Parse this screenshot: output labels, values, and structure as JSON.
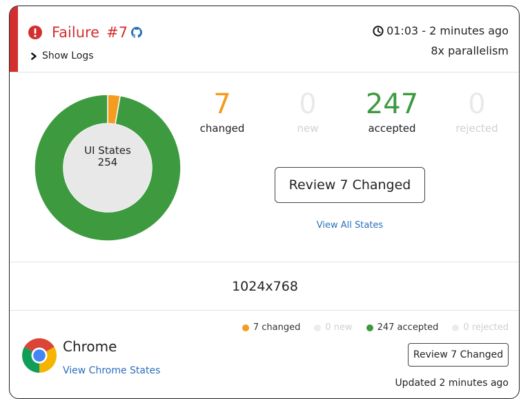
{
  "header": {
    "status": "Failure",
    "build_number": "#7",
    "show_logs_label": "Show Logs",
    "timing": "01:03 - 2 minutes ago",
    "parallelism": "8x parallelism"
  },
  "summary": {
    "donut": {
      "title": "UI States",
      "total": "254",
      "segments": [
        {
          "name": "changed",
          "value": 7,
          "color": "#f39c1f"
        },
        {
          "name": "new",
          "value": 0,
          "color": "#e9e9e9"
        },
        {
          "name": "accepted",
          "value": 247,
          "color": "#3d9a3f"
        },
        {
          "name": "rejected",
          "value": 0,
          "color": "#e9e9e9"
        }
      ]
    },
    "stats": [
      {
        "value": "7",
        "label": "changed"
      },
      {
        "value": "0",
        "label": "new"
      },
      {
        "value": "247",
        "label": "accepted"
      },
      {
        "value": "0",
        "label": "rejected"
      }
    ],
    "review_button": "Review 7 Changed",
    "view_all_link": "View All States"
  },
  "resolution": "1024x768",
  "browser": {
    "name": "Chrome",
    "view_states_link": "View Chrome States",
    "mini_stats": [
      {
        "label": "7 changed"
      },
      {
        "label": "0 new"
      },
      {
        "label": "247 accepted"
      },
      {
        "label": "0 rejected"
      }
    ],
    "review_button": "Review 7 Changed",
    "updated": "Updated 2 minutes ago"
  },
  "colors": {
    "failure": "#d32f2f",
    "changed": "#f39c1f",
    "accepted": "#3d9a3f",
    "link": "#2a6ebb",
    "muted": "#e9e9e9"
  },
  "icons": [
    "alert-circle-icon",
    "github-icon",
    "chevron-right-icon",
    "clock-icon",
    "chrome-logo"
  ]
}
